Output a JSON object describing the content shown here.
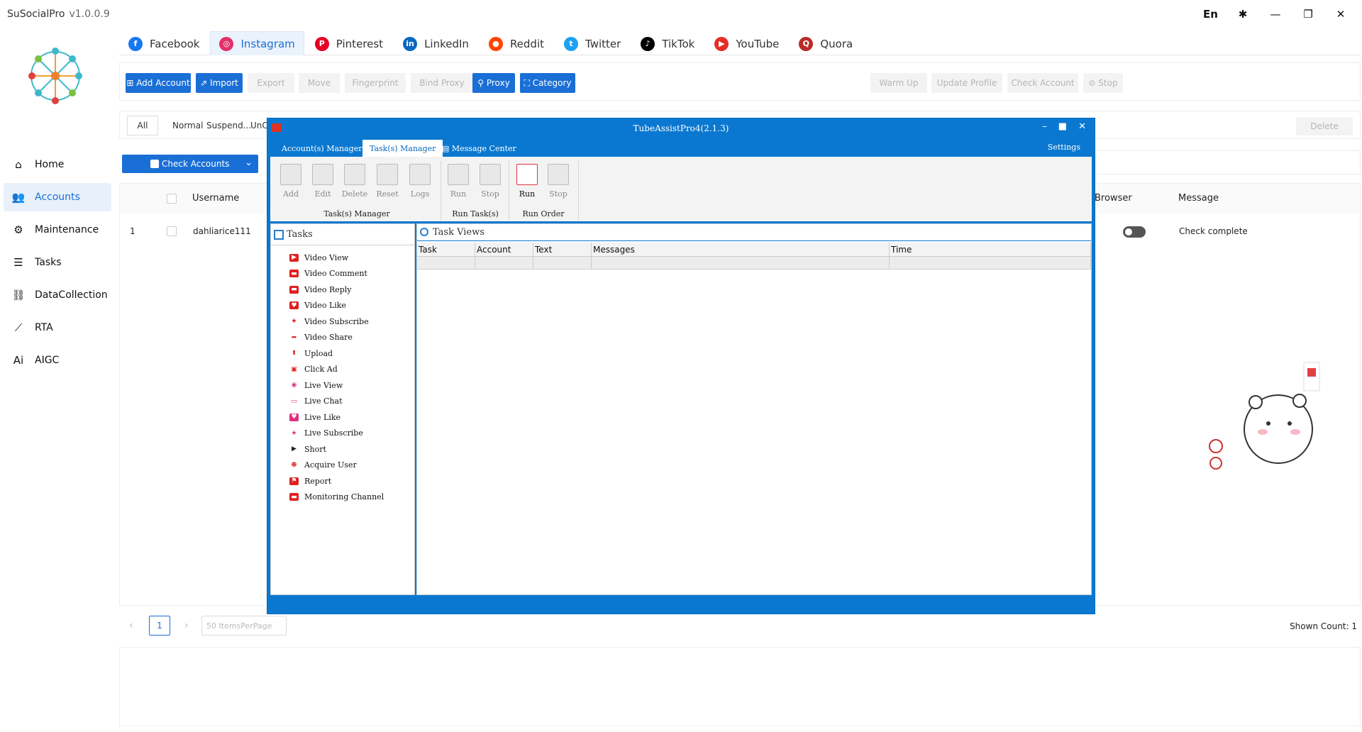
{
  "app": {
    "name": "SuSocialPro",
    "version": "v1.0.0.9",
    "lang": "En"
  },
  "sidebar": {
    "items": [
      {
        "label": "Home",
        "icon": "home-icon",
        "glyph": "⌂"
      },
      {
        "label": "Accounts",
        "icon": "users-icon",
        "glyph": "👥",
        "active": true
      },
      {
        "label": "Maintenance",
        "icon": "maintenance-icon",
        "glyph": "⚙"
      },
      {
        "label": "Tasks",
        "icon": "tasks-icon",
        "glyph": "☰"
      },
      {
        "label": "DataCollection",
        "icon": "datacollection-icon",
        "glyph": "⛓"
      },
      {
        "label": "RTA",
        "icon": "rta-icon",
        "glyph": "⟋"
      },
      {
        "label": "AIGC",
        "icon": "aigc-icon",
        "glyph": "Ai"
      }
    ]
  },
  "platforms": [
    {
      "label": "Facebook",
      "color": "#1877f2",
      "glyph": "f"
    },
    {
      "label": "Instagram",
      "color": "#e1306c",
      "glyph": "◎",
      "active": true
    },
    {
      "label": "Pinterest",
      "color": "#e60023",
      "glyph": "P"
    },
    {
      "label": "LinkedIn",
      "color": "#0a66c2",
      "glyph": "in"
    },
    {
      "label": "Reddit",
      "color": "#ff4500",
      "glyph": "●"
    },
    {
      "label": "Twitter",
      "color": "#1da1f2",
      "glyph": "t"
    },
    {
      "label": "TikTok",
      "color": "#000000",
      "glyph": "♪"
    },
    {
      "label": "YouTube",
      "color": "#e52d27",
      "glyph": "▶"
    },
    {
      "label": "Quora",
      "color": "#b92b27",
      "glyph": "Q"
    }
  ],
  "toolbar": {
    "add_account": "Add Account",
    "import": "Import",
    "export": "Export",
    "move": "Move",
    "fingerprint": "Fingerprint",
    "bind_proxy": "Bind Proxy",
    "proxy": "Proxy",
    "category": "Category",
    "warm_up": "Warm Up",
    "update_profile": "Update Profile",
    "check_account": "Check Account",
    "stop": "Stop"
  },
  "filter": {
    "all": "All",
    "normal": "Normal",
    "suspended": "Suspend...",
    "unc": "UnC",
    "delete": "Delete"
  },
  "check_accounts": "Check Accounts",
  "table": {
    "headers": {
      "username": "Username",
      "browser": "Browser",
      "message": "Message"
    },
    "rows": [
      {
        "index": "1",
        "username": "dahliarice111",
        "message": "Check complete"
      }
    ]
  },
  "pager": {
    "page": "1",
    "per_page": "50 ItemsPerPage",
    "shown_count": "Shown Count: 1"
  },
  "dialog": {
    "title": "TubeAssistPro4(2.1.3)",
    "tabs": {
      "accounts": "Account(s) Manager",
      "tasks": "Task(s) Manager",
      "messages": "Message Center"
    },
    "settings": "Settings",
    "ribbon": {
      "add": "Add",
      "edit": "Edit",
      "delete": "Delete",
      "reset": "Reset",
      "logs": "Logs",
      "run": "Run",
      "stop": "Stop",
      "run2": "Run",
      "stop2": "Stop",
      "group_tasks": "Task(s) Manager",
      "group_run": "Run Task(s)",
      "group_order": "Run Order"
    },
    "tasks_title": "Tasks",
    "tasks": [
      {
        "label": "Video View",
        "color": "#e02020",
        "glyph": "▶"
      },
      {
        "label": "Video Comment",
        "color": "#e02020",
        "glyph": "▬"
      },
      {
        "label": "Video Reply",
        "color": "#e02020",
        "glyph": "▬"
      },
      {
        "label": "Video Like",
        "color": "#e02020",
        "glyph": "♥"
      },
      {
        "label": "Video Subscribe",
        "color": "#ffffff",
        "glyph": "★",
        "fg": "#e02020"
      },
      {
        "label": "Video Share",
        "color": "#ffffff",
        "glyph": "➦",
        "fg": "#e02020"
      },
      {
        "label": "Upload",
        "color": "#ffffff",
        "glyph": "⬆",
        "fg": "#e02020"
      },
      {
        "label": "Click Ad",
        "color": "#ffffff",
        "glyph": "▣",
        "fg": "#e02020"
      },
      {
        "label": "Live View",
        "color": "#ffffff",
        "glyph": "◉",
        "fg": "#e03080"
      },
      {
        "label": "Live Chat",
        "color": "#ffffff",
        "glyph": "▭",
        "fg": "#e03080"
      },
      {
        "label": "Live Like",
        "color": "#e03080",
        "glyph": "♥"
      },
      {
        "label": "Live Subscribe",
        "color": "#ffffff",
        "glyph": "★",
        "fg": "#e03080"
      },
      {
        "label": "Short",
        "color": "#ffffff",
        "glyph": "▶",
        "fg": "#222"
      },
      {
        "label": "Acquire User",
        "color": "#ffffff",
        "glyph": "☻",
        "fg": "#e02020"
      },
      {
        "label": "Report",
        "color": "#e02020",
        "glyph": "⚑"
      },
      {
        "label": "Monitoring Channel",
        "color": "#e02020",
        "glyph": "▬"
      }
    ],
    "views_title": "Task Views",
    "columns": {
      "task": "Task",
      "account": "Account",
      "text": "Text",
      "messages": "Messages",
      "time": "Time"
    }
  }
}
